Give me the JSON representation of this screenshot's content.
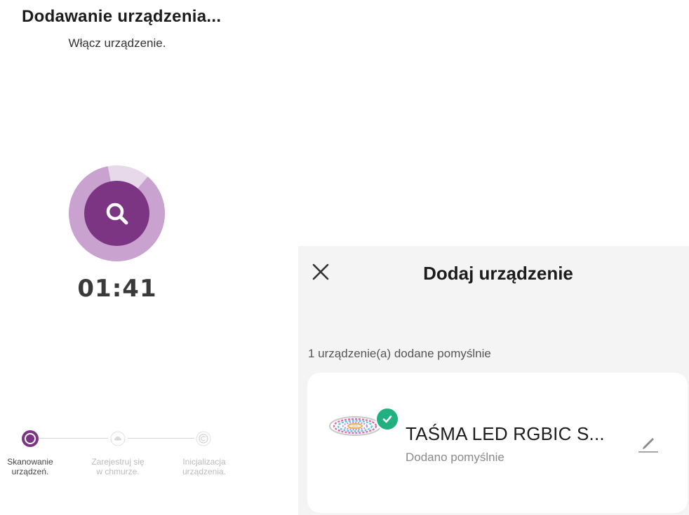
{
  "left_screen": {
    "title": "Dodawanie urządzenia...",
    "subtitle": "Włącz urządzenie.",
    "timer": "01:41",
    "scan_icon": "search-icon",
    "accent_color": "#7b3583",
    "steps": [
      {
        "label": "Skanowanie urządzeń.",
        "icon": "scan-step-icon",
        "state": "active"
      },
      {
        "label": "Zarejestruj się w chmurze.",
        "icon": "cloud-icon",
        "state": "pending"
      },
      {
        "label": "Inicjalizacja urządzenia.",
        "icon": "initialize-icon",
        "state": "pending"
      }
    ]
  },
  "right_screen": {
    "title": "Dodaj urządzenie",
    "close_icon": "close-icon",
    "success_message": "1 urządzenie(a) dodane pomyślnie",
    "device": {
      "name": "TAŚMA LED RGBIC S...",
      "status": "Dodano pomyślnie",
      "status_icon": "check-icon",
      "status_color": "#21b07f",
      "edit_icon": "edit-icon"
    }
  }
}
